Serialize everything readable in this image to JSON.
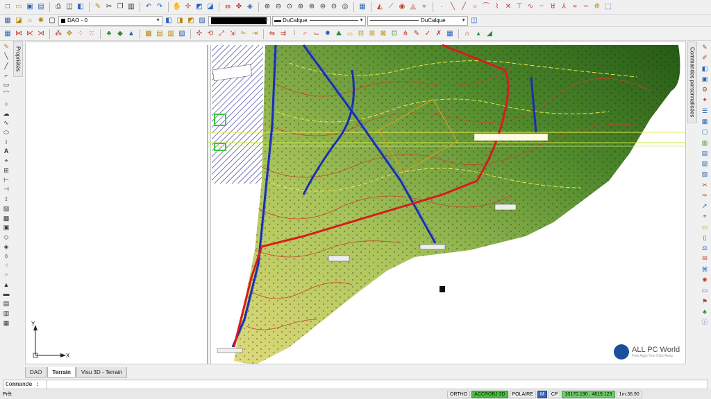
{
  "toolbar_row1": {
    "icons": [
      "new-file-icon",
      "open-folder-icon",
      "save-icon",
      "save-as-icon",
      "print-icon",
      "plot-preview-icon",
      "publish-icon",
      "match-properties-icon",
      "cut-icon",
      "copy-icon",
      "paste-icon",
      "undo-icon",
      "redo-icon",
      "pan-icon",
      "zoom-realtime-icon",
      "zoom-window-icon",
      "zoom-previous-icon",
      "zoom-extents-icon",
      "zoom-in-icon",
      "zoom-out-icon",
      "zoom-all-icon",
      "properties-icon",
      "design-center-icon",
      "tool-palette-icon",
      "line-icon",
      "polyline-icon",
      "circle-icon",
      "arc-icon",
      "rectangle-icon",
      "hatch-icon",
      "text-icon",
      "dimension-icon",
      "measure-icon",
      "curve-icon",
      "grip-icon",
      "help-icon"
    ],
    "badge_text": "20"
  },
  "toolbar_row2": {
    "layer_value": "DAO - 0",
    "color_value": "",
    "linetype_value": "DuCalque",
    "lineweight_value": "DuCalque"
  },
  "left_panel": {
    "tab_label": "Propriétés"
  },
  "right_panel": {
    "tab_label": "Commandes personnalisées"
  },
  "layout_tabs": [
    {
      "label": "DAO",
      "active": false
    },
    {
      "label": "Terrain",
      "active": true
    },
    {
      "label": "Visu 3D - Terrain",
      "active": false
    }
  ],
  "command_line": {
    "prompt": "Commande :",
    "value": ""
  },
  "status_bar": {
    "ready_text": "Prêt",
    "toggles": [
      {
        "label": "ORTHO",
        "on": false
      },
      {
        "label": "ACCROBJ 3D",
        "on": true
      },
      {
        "label": "POLAIRE",
        "on": false
      },
      {
        "label": "M",
        "on": "blue"
      },
      {
        "label": "CP",
        "on": false
      }
    ],
    "coordinates": "10170.190 , 4619.123",
    "scale_text": "1m:38.90"
  },
  "ucs": {
    "x_label": "X",
    "y_label": "Y"
  },
  "watermark": {
    "title": "ALL PC World",
    "subtitle": "Free Apps One Click Away"
  },
  "colors": {
    "terrain_dark": "#2f6b1c",
    "terrain_light": "#d4d46a",
    "road_red": "#d81b1b",
    "pipe_blue": "#1a2fb0",
    "contour_yellow": "#e8e848"
  }
}
